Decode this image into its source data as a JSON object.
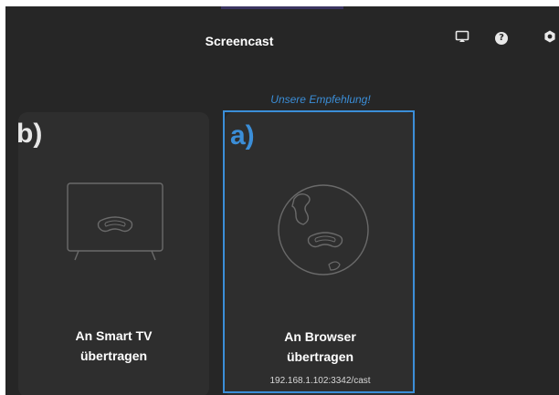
{
  "header": {
    "title": "Screencast",
    "icons": [
      "cast-icon",
      "help-icon",
      "settings-icon"
    ],
    "help_glyph": "?"
  },
  "recommendation": "Unsere Empfehlung!",
  "cards": [
    {
      "marker": "b)",
      "label_line1": "An Smart TV",
      "label_line2": "übertragen",
      "icon": "smart-tv-icon"
    },
    {
      "marker": "a)",
      "label_line1": "An Browser",
      "label_line2": "übertragen",
      "address": "192.168.1.102:3342/cast",
      "icon": "globe-icon",
      "selected": true
    }
  ],
  "colors": {
    "background": "#262626",
    "card": "#2e2e2e",
    "accent": "#3b8ed8",
    "text": "#ffffff"
  }
}
